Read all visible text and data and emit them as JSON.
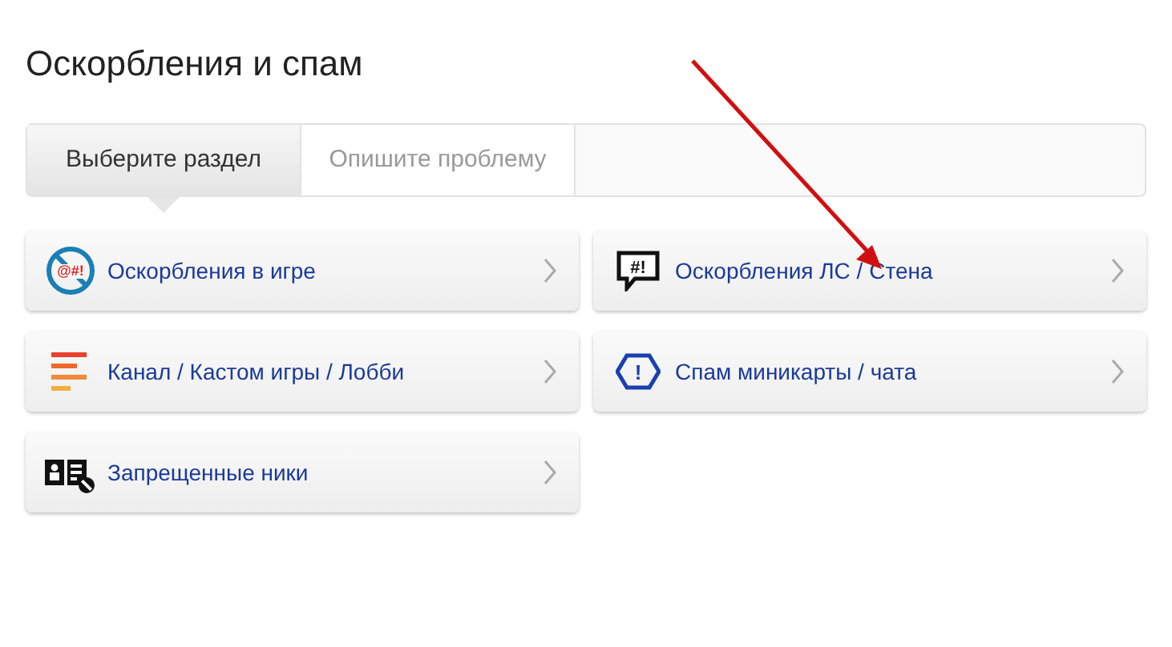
{
  "title": "Оскорбления и спам",
  "tabs": [
    {
      "label": "Выберите раздел",
      "selected": true
    },
    {
      "label": "Опишите проблему",
      "selected": false
    }
  ],
  "sections": [
    {
      "label": "Оскорбления в игре",
      "kind": "no-swear",
      "glyph": "@#!"
    },
    {
      "label": "Оскорбления ЛС / Стена",
      "kind": "speech",
      "glyph": "#!"
    },
    {
      "label": "Канал / Кастом игры / Лобби",
      "kind": "bars"
    },
    {
      "label": "Спам миникарты / чата",
      "kind": "hex-alert",
      "glyph": "!"
    },
    {
      "label": "Запрещенные ники",
      "kind": "id-card"
    }
  ]
}
